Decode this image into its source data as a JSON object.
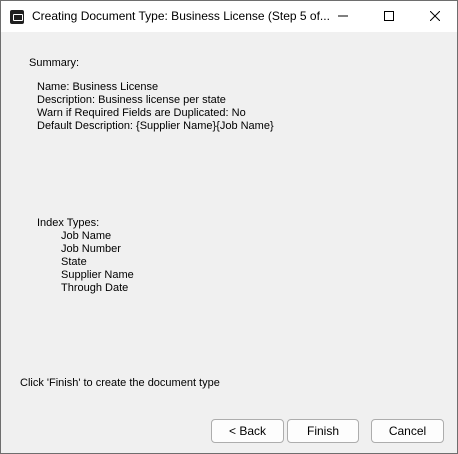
{
  "window": {
    "title": "Creating Document Type: Business License (Step 5 of..."
  },
  "summary": {
    "label": "Summary:",
    "name": "Name: Business License",
    "description": "Description: Business license per state",
    "warn": "Warn if Required Fields are Duplicated: No",
    "default_description": "Default Description: {Supplier Name}{Job Name}"
  },
  "index_types": {
    "label": "Index Types:",
    "items": [
      "Job Name",
      "Job Number",
      "State",
      "Supplier Name",
      "Through Date"
    ]
  },
  "instruction": "Click 'Finish' to create the document type",
  "buttons": {
    "back": "< Back",
    "finish": "Finish",
    "cancel": "Cancel"
  },
  "icons": {
    "app": "app-icon",
    "minimize": "minimize-icon",
    "maximize": "maximize-icon",
    "close": "close-icon"
  }
}
